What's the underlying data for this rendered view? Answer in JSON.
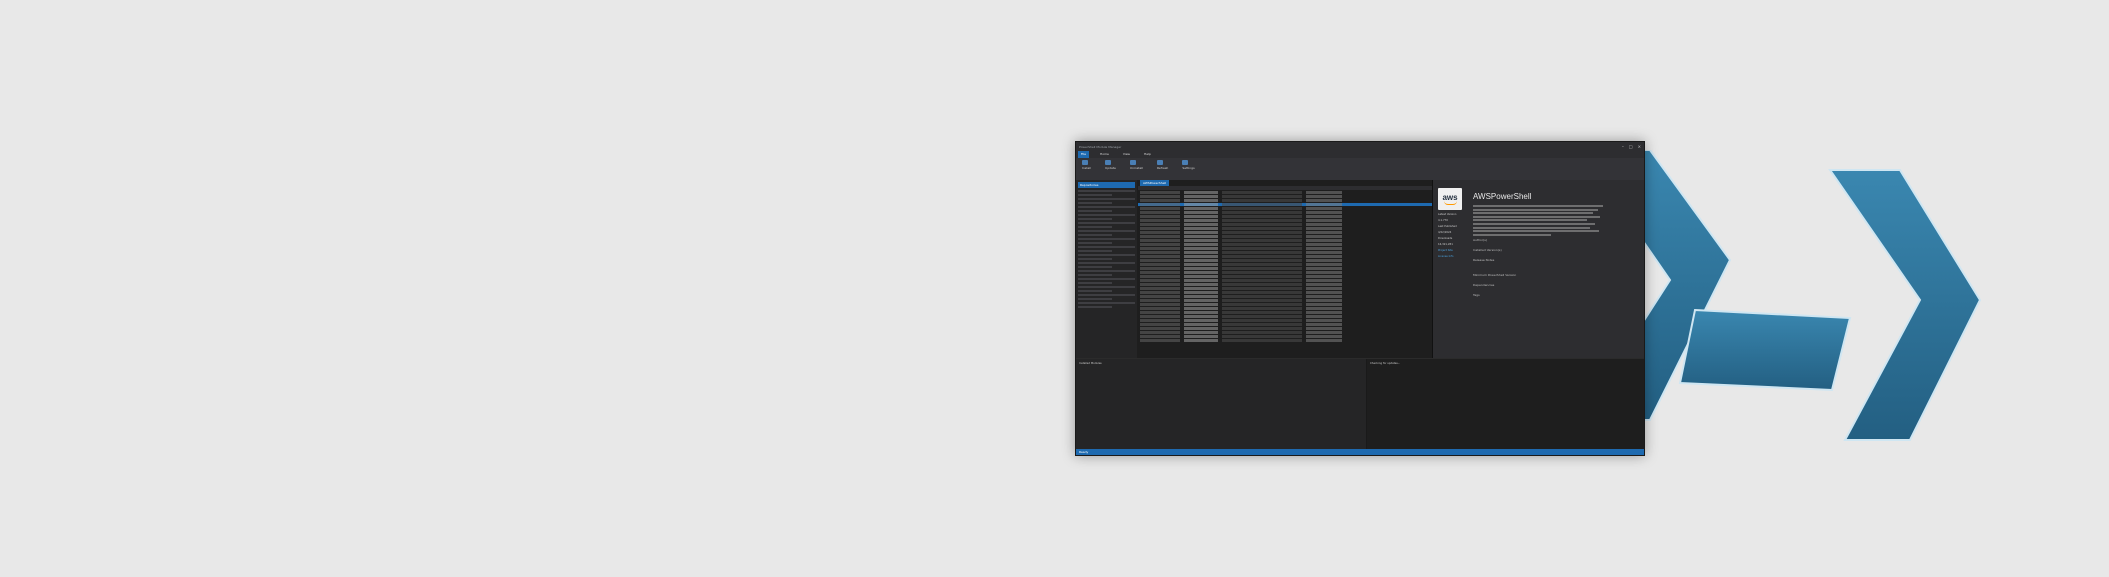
{
  "app": {
    "window_title": "PowerShell Module Manager",
    "ribbon_tabs": [
      "File",
      "Home",
      "View",
      "Help"
    ],
    "ribbon_groups": [
      "Install",
      "Update",
      "Uninstall",
      "Refresh",
      "Settings"
    ],
    "sidebar_title": "Repositories",
    "grid_tab": "AWSPowerShell",
    "status": "Ready"
  },
  "detail": {
    "logo_text": "aws",
    "name": "AWSPowerShell",
    "meta": [
      "Latest Version",
      "4.1.770",
      "Last Published",
      "4/22/2024",
      "Downloads",
      "16,321,281",
      "Project Site",
      "License Info"
    ],
    "sections": [
      "Author(s)",
      "Installed Version(s)",
      "Release Notes",
      "Minimum PowerShell Version",
      "Dependencies",
      "Tags"
    ]
  },
  "bottom": {
    "left_text": "Installed Modules",
    "right_text": "Checking for updates..."
  },
  "colors": {
    "accent": "#1e6ab0",
    "logo_blue": "#2f6f95"
  }
}
